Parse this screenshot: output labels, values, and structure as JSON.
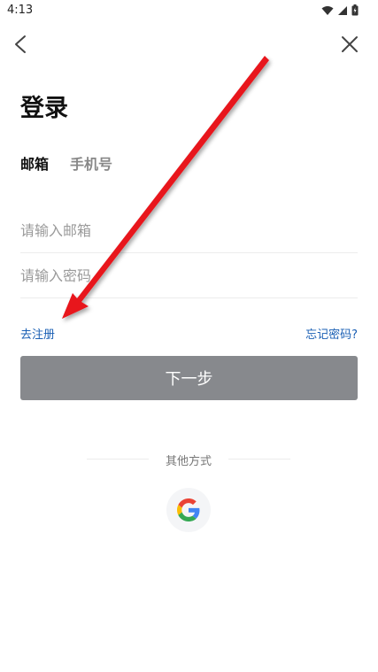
{
  "status_bar": {
    "time": "4:13",
    "icons": [
      "wifi-icon",
      "signal-icon",
      "battery-icon"
    ]
  },
  "nav": {
    "back_icon": "chevron-left-icon",
    "close_icon": "close-icon"
  },
  "page": {
    "title": "登录"
  },
  "tabs": [
    {
      "label": "邮箱",
      "active": true
    },
    {
      "label": "手机号",
      "active": false
    }
  ],
  "form": {
    "email_placeholder": "请输入邮箱",
    "email_value": "",
    "password_placeholder": "请输入密码",
    "password_value": ""
  },
  "links": {
    "register": "去注册",
    "forgot_password": "忘记密码?"
  },
  "buttons": {
    "next": "下一步"
  },
  "other_login": {
    "label": "其他方式",
    "providers": [
      "google-icon"
    ]
  },
  "colors": {
    "link": "#1a5fb4",
    "button_bg": "#87898d",
    "annotation_arrow": "#e8121a"
  }
}
